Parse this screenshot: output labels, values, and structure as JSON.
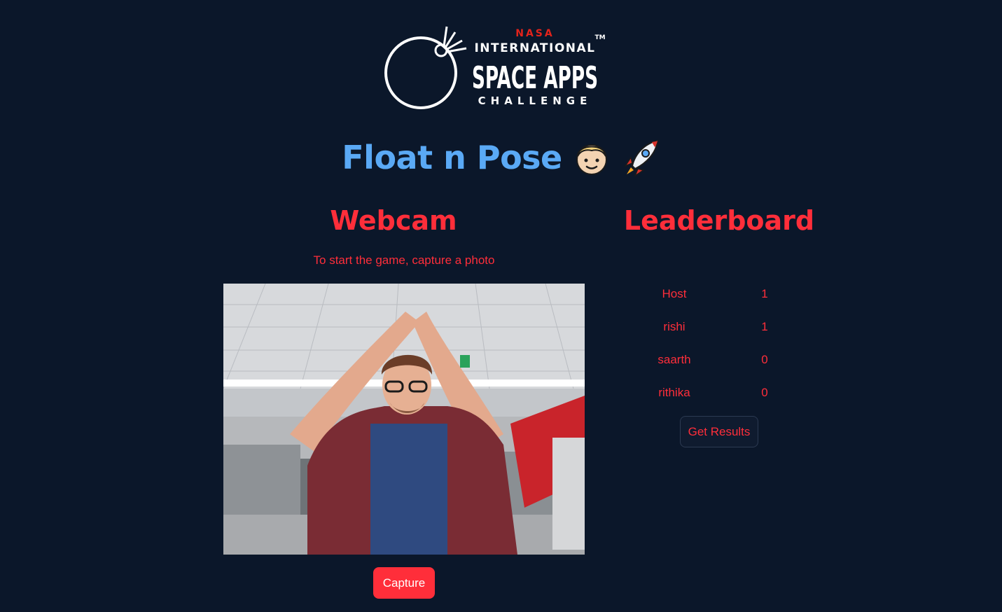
{
  "logo": {
    "brand": "NASA",
    "line1": "INTERNATIONAL",
    "line2": "SPACE APPS",
    "line3": "CHALLENGE",
    "trademark": "TM"
  },
  "title": {
    "text": "Float n Pose",
    "emojis": [
      "person-icon",
      "rocket-icon"
    ]
  },
  "webcam": {
    "heading": "Webcam",
    "hint": "To start the game, capture a photo",
    "capture_label": "Capture"
  },
  "leaderboard": {
    "heading": "Leaderboard",
    "rows": [
      {
        "name": "Host",
        "score": "1"
      },
      {
        "name": "rishi",
        "score": "1"
      },
      {
        "name": "saarth",
        "score": "0"
      },
      {
        "name": "rithika",
        "score": "0"
      }
    ],
    "results_label": "Get Results"
  },
  "colors": {
    "background": "#0b172a",
    "accent": "#ff2e3a",
    "title": "#5aa9f5"
  }
}
